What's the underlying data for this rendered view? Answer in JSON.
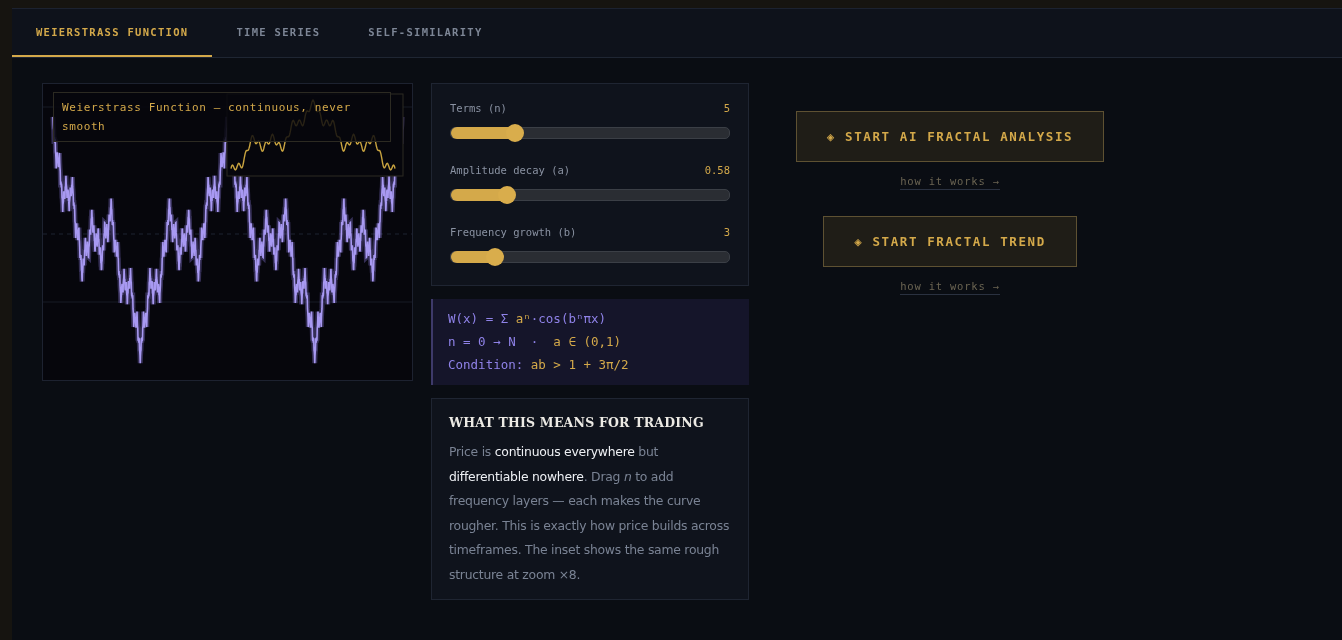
{
  "tabs": [
    {
      "label": "WEIERSTRASS FUNCTION",
      "selected": true
    },
    {
      "label": "TIME SERIES",
      "selected": false
    },
    {
      "label": "SELF-SIMILARITY",
      "selected": false
    }
  ],
  "plot": {
    "title": "Weierstrass Function — continuous, never smooth"
  },
  "sliders": [
    {
      "label": "Terms (n)",
      "reading": "5",
      "level": 0.23
    },
    {
      "label": "Amplitude decay (a)",
      "reading": "0.58",
      "level": 0.2
    },
    {
      "label": "Frequency growth (b)",
      "reading": "3",
      "level": 0.16
    }
  ],
  "formula": [
    {
      "parts": [
        {
          "text": "W(x) = Σ ",
          "accent": false
        },
        {
          "text": "aⁿ",
          "accent": true
        },
        {
          "text": "·cos(bⁿπx)",
          "accent": false
        }
      ]
    },
    {
      "parts": [
        {
          "text": "n = 0 → N  ·  ",
          "accent": false
        },
        {
          "text": "a ∈ (0,1)",
          "accent": true
        }
      ]
    },
    {
      "parts": [
        {
          "text": "Condition: ",
          "accent": false
        },
        {
          "text": "ab > 1 + 3π/2",
          "accent": true
        }
      ]
    }
  ],
  "card": {
    "title": "WHAT THIS MEANS FOR TRADING",
    "body": "Price is **continuous everywhere** but **differentiable nowhere**. Drag *n* to add frequency layers — each makes the curve rougher. This is exactly how price builds across timeframes. The inset shows the same rough structure at zoom ×8."
  },
  "actions": [
    {
      "label": "◈ START AI FRACTAL ANALYSIS",
      "link": "how it works →"
    },
    {
      "label": "◈ START FRACTAL TREND",
      "link": "how it works →"
    }
  ]
}
